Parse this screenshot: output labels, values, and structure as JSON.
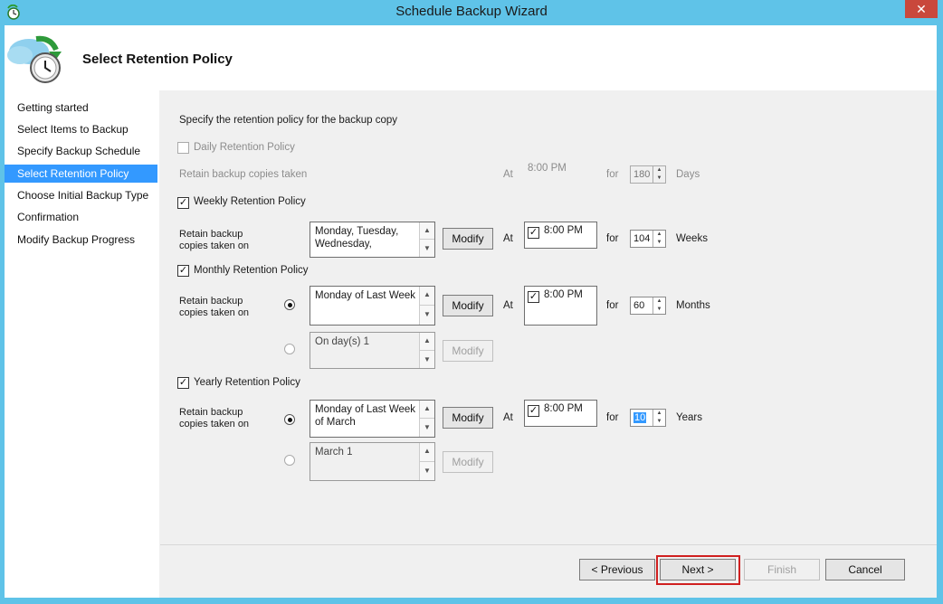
{
  "window": {
    "title": "Schedule Backup Wizard",
    "close_glyph": "✕"
  },
  "header": {
    "title": "Select Retention Policy",
    "icon": "backup-schedule-clock-icon"
  },
  "nav": {
    "items": [
      {
        "label": "Getting started"
      },
      {
        "label": "Select Items to Backup"
      },
      {
        "label": "Specify Backup Schedule"
      },
      {
        "label": "Select Retention Policy",
        "active": true
      },
      {
        "label": "Choose Initial Backup Type"
      },
      {
        "label": "Confirmation"
      },
      {
        "label": "Modify Backup Progress"
      }
    ]
  },
  "main": {
    "instruction": "Specify the retention policy for the backup copy",
    "daily": {
      "label": "Daily Retention Policy",
      "checked": false,
      "enabled": false,
      "retain_label": "Retain backup copies taken",
      "at_label": "At",
      "time": "8:00 PM",
      "for_label": "for",
      "count": "180",
      "unit": "Days"
    },
    "weekly": {
      "label": "Weekly Retention Policy",
      "checked": true,
      "retain_label_line1": "Retain backup",
      "retain_label_line2": "copies taken on",
      "days_line1": "Monday, Tuesday,",
      "days_line2": "Wednesday,",
      "modify_label": "Modify",
      "at_label": "At",
      "time": "8:00 PM",
      "for_label": "for",
      "count": "104",
      "unit": "Weeks"
    },
    "monthly": {
      "label": "Monthly Retention Policy",
      "checked": true,
      "retain_label_line1": "Retain backup",
      "retain_label_line2": "copies taken on",
      "option1": "Monday of Last Week",
      "option1_selected": true,
      "option2": "On day(s) 1",
      "option2_selected": false,
      "modify_label": "Modify",
      "at_label": "At",
      "time": "8:00 PM",
      "for_label": "for",
      "count": "60",
      "unit": "Months"
    },
    "yearly": {
      "label": "Yearly Retention Policy",
      "checked": true,
      "retain_label_line1": "Retain backup",
      "retain_label_line2": "copies taken on",
      "option1_line1": "Monday of Last Week",
      "option1_line2": "of March",
      "option1_selected": true,
      "option2": "March 1",
      "option2_selected": false,
      "modify_label": "Modify",
      "at_label": "At",
      "time": "8:00 PM",
      "for_label": "for",
      "count": "10",
      "unit": "Years"
    }
  },
  "footer": {
    "previous": "< Previous",
    "next": "Next >",
    "finish": "Finish",
    "cancel": "Cancel"
  },
  "colors": {
    "titlebar": "#5fc3e8",
    "nav_active": "#3399ff",
    "highlight": "#d02020"
  }
}
